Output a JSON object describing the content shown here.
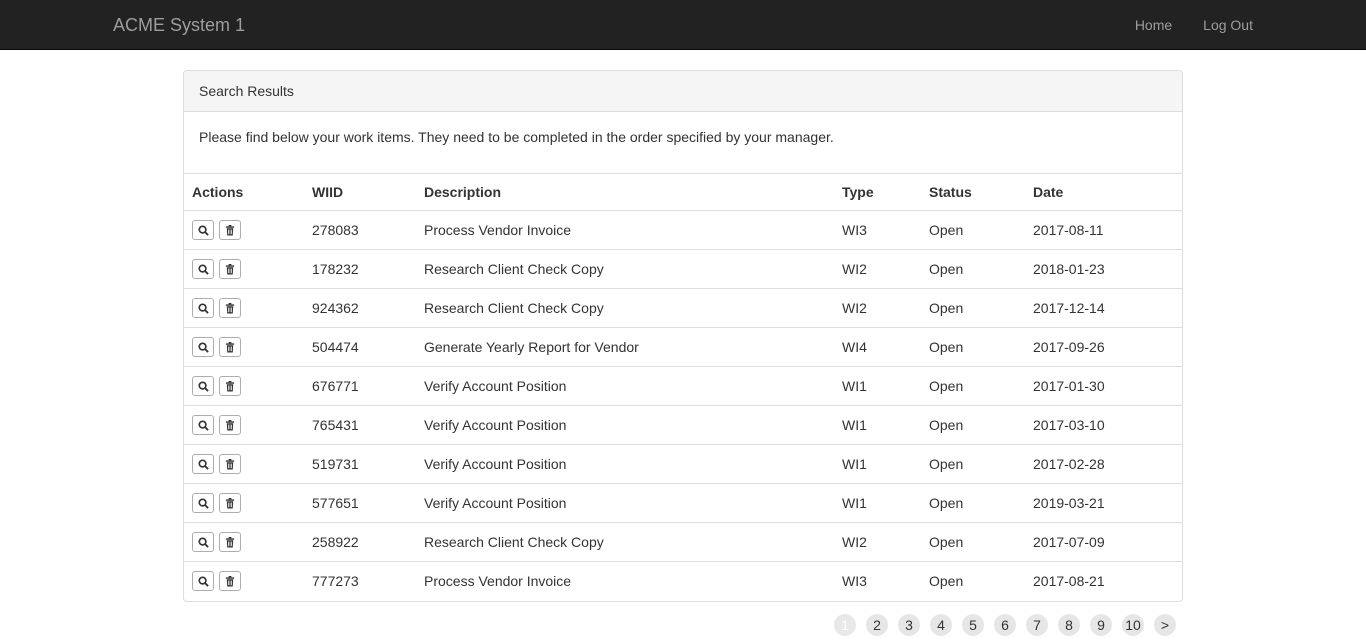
{
  "app": {
    "brand": "ACME System 1",
    "nav": {
      "home": "Home",
      "logout": "Log Out"
    }
  },
  "panel": {
    "heading": "Search Results",
    "intro": "Please find below your work items. They need to be completed in the order specified by your manager."
  },
  "table": {
    "headers": {
      "actions": "Actions",
      "wiid": "WIID",
      "description": "Description",
      "type": "Type",
      "status": "Status",
      "date": "Date"
    },
    "rows": [
      {
        "wiid": "278083",
        "description": "Process Vendor Invoice",
        "type": "WI3",
        "status": "Open",
        "date": "2017-08-11"
      },
      {
        "wiid": "178232",
        "description": "Research Client Check Copy",
        "type": "WI2",
        "status": "Open",
        "date": "2018-01-23"
      },
      {
        "wiid": "924362",
        "description": "Research Client Check Copy",
        "type": "WI2",
        "status": "Open",
        "date": "2017-12-14"
      },
      {
        "wiid": "504474",
        "description": "Generate Yearly Report for Vendor",
        "type": "WI4",
        "status": "Open",
        "date": "2017-09-26"
      },
      {
        "wiid": "676771",
        "description": "Verify Account Position",
        "type": "WI1",
        "status": "Open",
        "date": "2017-01-30"
      },
      {
        "wiid": "765431",
        "description": "Verify Account Position",
        "type": "WI1",
        "status": "Open",
        "date": "2017-03-10"
      },
      {
        "wiid": "519731",
        "description": "Verify Account Position",
        "type": "WI1",
        "status": "Open",
        "date": "2017-02-28"
      },
      {
        "wiid": "577651",
        "description": "Verify Account Position",
        "type": "WI1",
        "status": "Open",
        "date": "2019-03-21"
      },
      {
        "wiid": "258922",
        "description": "Research Client Check Copy",
        "type": "WI2",
        "status": "Open",
        "date": "2017-07-09"
      },
      {
        "wiid": "777273",
        "description": "Process Vendor Invoice",
        "type": "WI3",
        "status": "Open",
        "date": "2017-08-21"
      }
    ]
  },
  "pagination": {
    "pages": [
      "1",
      "2",
      "3",
      "4",
      "5",
      "6",
      "7",
      "8",
      "9",
      "10"
    ],
    "current": "1",
    "next": ">"
  },
  "icons": {
    "view": "search-icon",
    "delete": "trash-icon"
  }
}
